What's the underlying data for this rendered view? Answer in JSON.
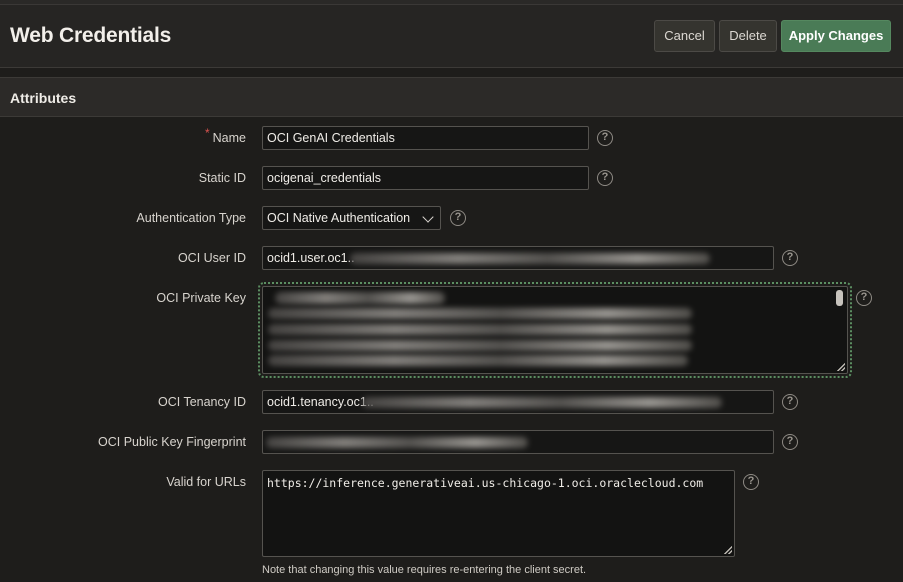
{
  "header": {
    "title": "Web Credentials",
    "cancel_label": "Cancel",
    "delete_label": "Delete",
    "apply_label": "Apply Changes"
  },
  "region": {
    "title": "Attributes"
  },
  "fields": {
    "name": {
      "label": "Name",
      "required_mark": "*",
      "value": "OCI GenAI Credentials"
    },
    "static_id": {
      "label": "Static ID",
      "value": "ocigenai_credentials"
    },
    "auth_type": {
      "label": "Authentication Type",
      "value": "OCI Native Authentication"
    },
    "oci_user_id": {
      "label": "OCI User ID",
      "value_prefix": "ocid1.user.oc1.."
    },
    "oci_private_key": {
      "label": "OCI Private Key"
    },
    "oci_tenancy_id": {
      "label": "OCI Tenancy ID",
      "value_prefix": "ocid1.tenancy.oc1.."
    },
    "oci_fingerprint": {
      "label": "OCI Public Key Fingerprint"
    },
    "valid_urls": {
      "label": "Valid for URLs",
      "value": "https://inference.generativeai.us-chicago-1.oci.oraclecloud.com",
      "note": "Note that changing this value requires re-entering the client secret."
    }
  },
  "help_glyph": "?",
  "colors": {
    "primary_button": "#4a7b56",
    "required": "#d9534f",
    "focus_outline": "#5c8f62"
  }
}
